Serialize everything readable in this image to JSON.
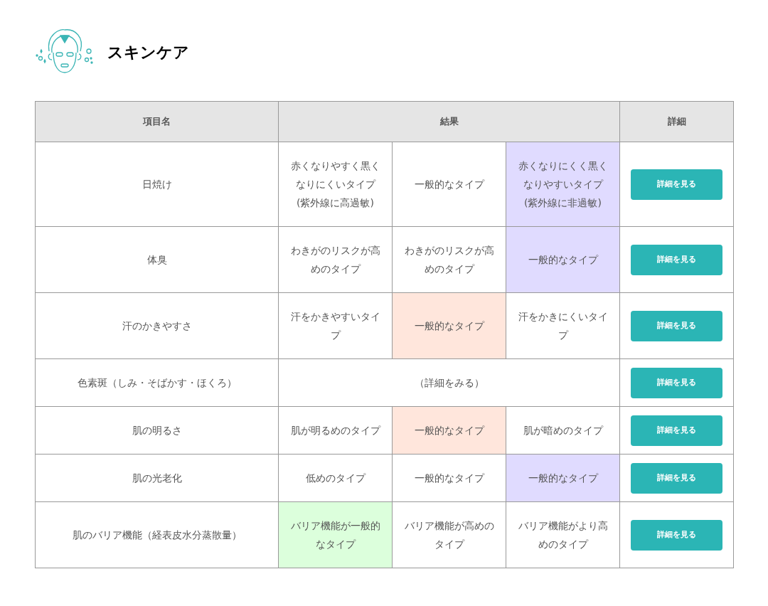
{
  "title": "スキンケア",
  "table": {
    "columns": [
      "項目名",
      "結果",
      "詳細"
    ],
    "rows": [
      {
        "item": "日焼け",
        "results": [
          {
            "text": "赤くなりやすく黒くなりにくいタイプ(紫外線に高過敏)"
          },
          {
            "text": "一般的なタイプ"
          },
          {
            "text": "赤くなりにくく黒くなりやすいタイプ(紫外線に非過敏)",
            "color": "#e0dbff"
          }
        ],
        "button": "詳細を見る"
      },
      {
        "item": "体臭",
        "results": [
          {
            "text": "わきがのリスクが高めのタイプ"
          },
          {
            "text": "わきがのリスクが高めのタイプ"
          },
          {
            "text": "一般的なタイプ",
            "color": "#e0dbff"
          }
        ],
        "button": "詳細を見る"
      },
      {
        "item": "汗のかきやすさ",
        "results": [
          {
            "text": "汗をかきやすいタイプ"
          },
          {
            "text": "一般的なタイプ",
            "color": "#ffe6dc"
          },
          {
            "text": "汗をかきにくいタイプ"
          }
        ],
        "button": "詳細を見る"
      },
      {
        "item": "色素斑（しみ・そばかす・ほくろ）",
        "results": [
          {
            "text": "（詳細をみる）"
          }
        ],
        "button": "詳細を見る"
      },
      {
        "item": "肌の明るさ",
        "results": [
          {
            "text": "肌が明るめのタイプ"
          },
          {
            "text": "一般的なタイプ",
            "color": "#ffe6dc"
          },
          {
            "text": "肌が暗めのタイプ"
          }
        ],
        "button": "詳細を見る"
      },
      {
        "item": "肌の光老化",
        "results": [
          {
            "text": "低めのタイプ"
          },
          {
            "text": "一般的なタイプ"
          },
          {
            "text": "一般的なタイプ",
            "color": "#e0dbff"
          }
        ],
        "button": "詳細を見る"
      },
      {
        "item": "肌のバリア機能（経表皮水分蒸散量）",
        "results": [
          {
            "text": "バリア機能が一般的なタイプ",
            "color": "#dcffdc"
          },
          {
            "text": "バリア機能が高めのタイプ"
          },
          {
            "text": "バリア機能がより高めのタイプ"
          }
        ],
        "button": "詳細を見る"
      }
    ]
  }
}
